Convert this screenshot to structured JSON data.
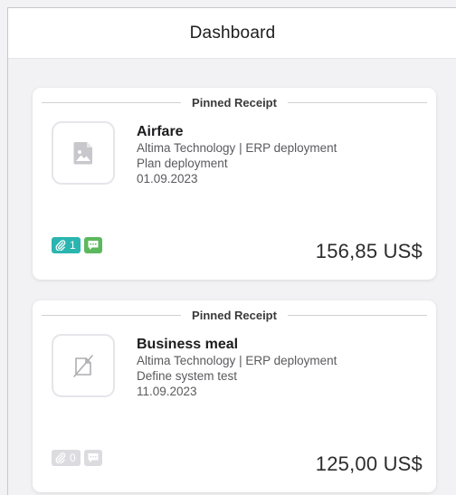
{
  "header": {
    "title": "Dashboard"
  },
  "receipts": [
    {
      "pinned_label": "Pinned Receipt",
      "icon": "image-icon",
      "title": "Airfare",
      "line1": "Altima Technology | ERP deployment",
      "line2": "Plan deployment",
      "date": "01.09.2023",
      "attachment_count": "1",
      "attachment_color": "#2bb5b0",
      "comment_color": "#5cb85c",
      "amount": "156,85 US$"
    },
    {
      "pinned_label": "Pinned Receipt",
      "icon": "no-receipt-icon",
      "title": "Business meal",
      "line1": "Altima Technology | ERP deployment",
      "line2": "Define system test",
      "date": "11.09.2023",
      "attachment_count": "0",
      "attachment_color": "#dcdce0",
      "comment_color": "#dcdce0",
      "amount": "125,00 US$"
    }
  ]
}
